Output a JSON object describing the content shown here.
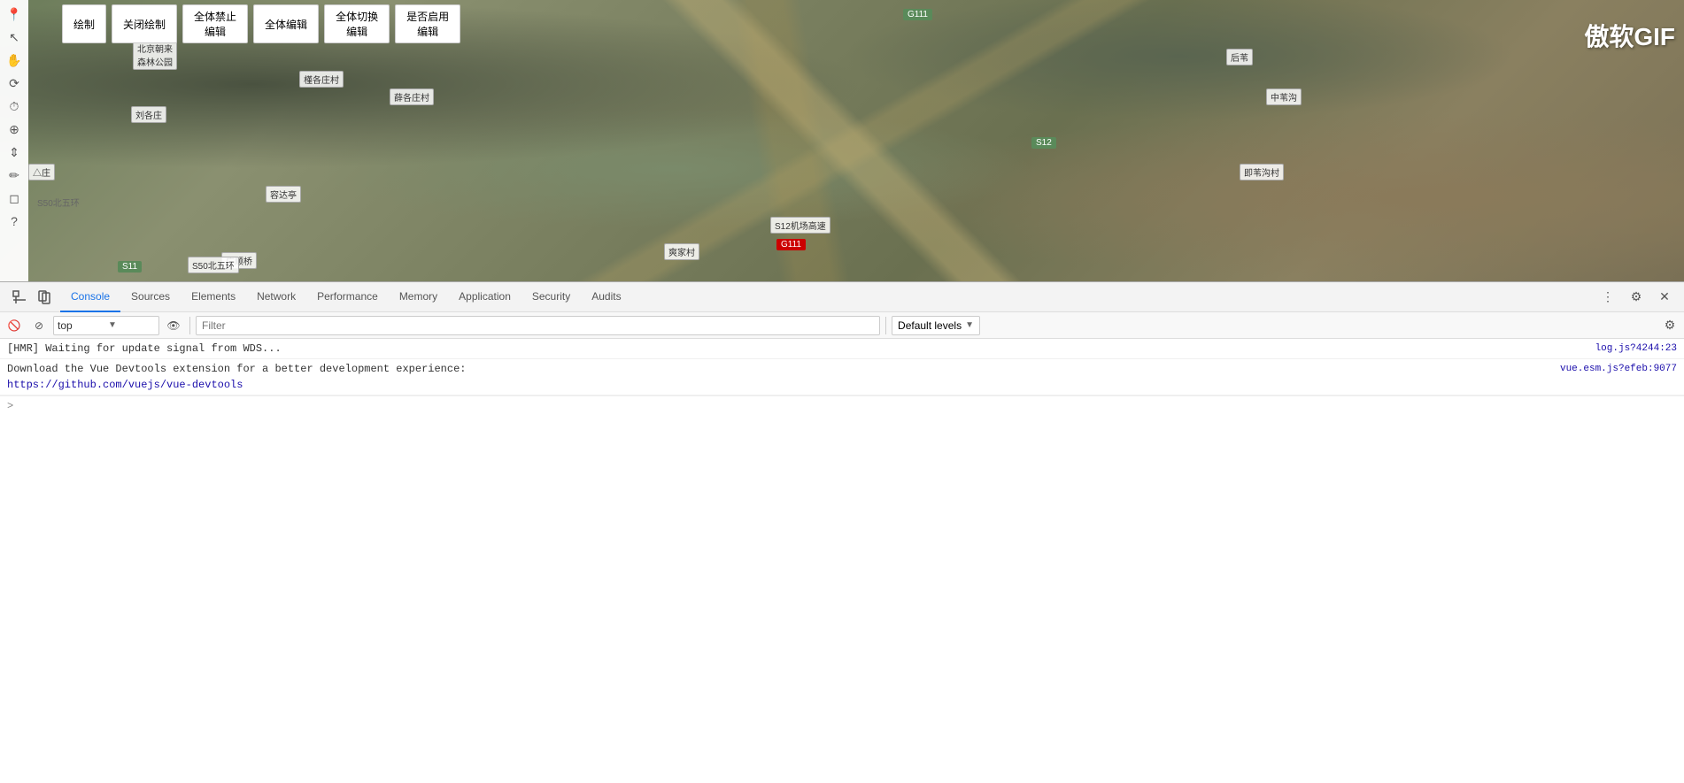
{
  "map": {
    "watermark": "傲软GIF",
    "toolbar_buttons": [
      {
        "id": "draw",
        "label": "绘制"
      },
      {
        "id": "close-draw",
        "label": "关闭绘制"
      },
      {
        "id": "disable-all-edit",
        "label": "全体禁止\n编辑"
      },
      {
        "id": "enable-all-edit",
        "label": "全体编辑"
      },
      {
        "id": "toggle-all-edit",
        "label": "全体切换\n编辑"
      },
      {
        "id": "toggle-enable",
        "label": "是否启用\n编辑"
      }
    ],
    "road_labels": [
      {
        "text": "S50北五环",
        "style": "white"
      },
      {
        "text": "S50北五环",
        "style": "white"
      },
      {
        "text": "G111",
        "style": "green"
      },
      {
        "text": "G111",
        "style": "red"
      },
      {
        "text": "S12",
        "style": "green"
      },
      {
        "text": "S12机场高速",
        "style": "white"
      },
      {
        "text": "后苇",
        "style": "white"
      },
      {
        "text": "中苇沟",
        "style": "white"
      },
      {
        "text": "北京朝来森林公园",
        "style": "white"
      },
      {
        "text": "刘各庄",
        "style": "white"
      },
      {
        "text": "槿各庄村",
        "style": "white"
      },
      {
        "text": "薛各庄村",
        "style": "white"
      },
      {
        "text": "容达亭",
        "style": "white"
      },
      {
        "text": "广顺桥",
        "style": "white"
      },
      {
        "text": "爽家村",
        "style": "white"
      },
      {
        "text": "即苇沟村",
        "style": "white"
      },
      {
        "text": "S11",
        "style": "green"
      },
      {
        "text": "So...",
        "style": "white"
      }
    ],
    "map_icon": "📍"
  },
  "devtools": {
    "tabs": [
      {
        "id": "console",
        "label": "Console",
        "active": true
      },
      {
        "id": "sources",
        "label": "Sources",
        "active": false
      },
      {
        "id": "elements",
        "label": "Elements",
        "active": false
      },
      {
        "id": "network",
        "label": "Network",
        "active": false
      },
      {
        "id": "performance",
        "label": "Performance",
        "active": false
      },
      {
        "id": "memory",
        "label": "Memory",
        "active": false
      },
      {
        "id": "application",
        "label": "Application",
        "active": false
      },
      {
        "id": "security",
        "label": "Security",
        "active": false
      },
      {
        "id": "audits",
        "label": "Audits",
        "active": false
      }
    ],
    "toolbar": {
      "context_value": "top",
      "context_arrow": "▼",
      "filter_placeholder": "Filter",
      "levels_label": "Default levels",
      "levels_arrow": "▼"
    },
    "console_lines": [
      {
        "id": "line1",
        "text": "[HMR] Waiting for update signal from WDS...",
        "source": "log.js?4244:23",
        "has_link": false
      },
      {
        "id": "line2",
        "text": "Download the Vue Devtools extension for a better development experience:",
        "source": "vue.esm.js?efeb:9077",
        "has_link": true,
        "link_text": "https://github.com/vuejs/vue-devtools",
        "link_href": "https://github.com/vuejs/vue-devtools"
      }
    ],
    "prompt": {
      "arrow": ">",
      "placeholder": ""
    },
    "sidebar_arrow": ">",
    "more_icon": "⋮",
    "close_label": "✕"
  }
}
